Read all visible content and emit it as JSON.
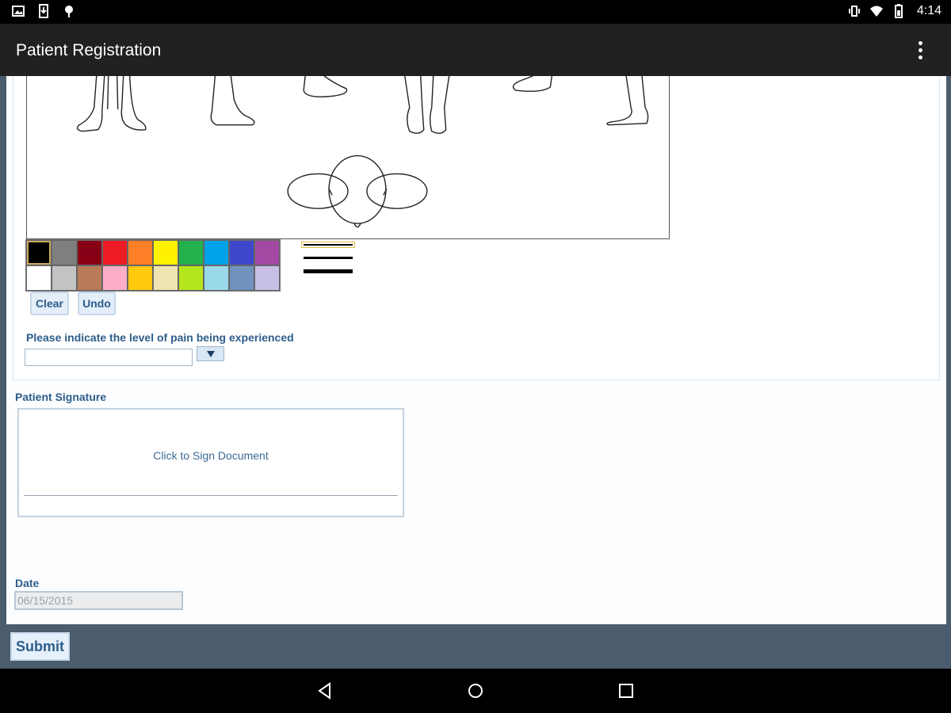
{
  "status_bar": {
    "time": "4:14",
    "left_icons": [
      "image-icon",
      "download-icon",
      "android-icon"
    ],
    "right_icons": [
      "vibrate-icon",
      "wifi-icon",
      "battery-icon"
    ]
  },
  "app_bar": {
    "title": "Patient Registration",
    "menu_icon": "overflow-menu-icon"
  },
  "drawing_tool": {
    "palette_colors": [
      "#000000",
      "#7f7f7f",
      "#880015",
      "#ed1c24",
      "#ff7f27",
      "#fff200",
      "#22b14c",
      "#00a2e8",
      "#3f48cc",
      "#a349a4",
      "#ffffff",
      "#c3c3c3",
      "#b97a57",
      "#ffaec9",
      "#ffc90e",
      "#efe4b0",
      "#b5e61d",
      "#99d9ea",
      "#7092be",
      "#c8bfe7"
    ],
    "selected_color_index": 0,
    "line_widths": [
      "thin",
      "medium",
      "thick"
    ],
    "selected_line_width_index": 0,
    "clear_label": "Clear",
    "undo_label": "Undo"
  },
  "pain_level": {
    "label": "Please indicate the level of pain being experienced",
    "value": ""
  },
  "signature": {
    "label": "Patient Signature",
    "prompt": "Click to Sign Document"
  },
  "date": {
    "label": "Date",
    "value": "06/15/2015"
  },
  "submit_label": "Submit",
  "nav_bar": {
    "buttons": [
      "back-icon",
      "home-icon",
      "recents-icon"
    ]
  },
  "colors": {
    "label_blue": "#2d5d8b",
    "app_bar": "#212121",
    "footer_bg": "#4a5c6e"
  }
}
